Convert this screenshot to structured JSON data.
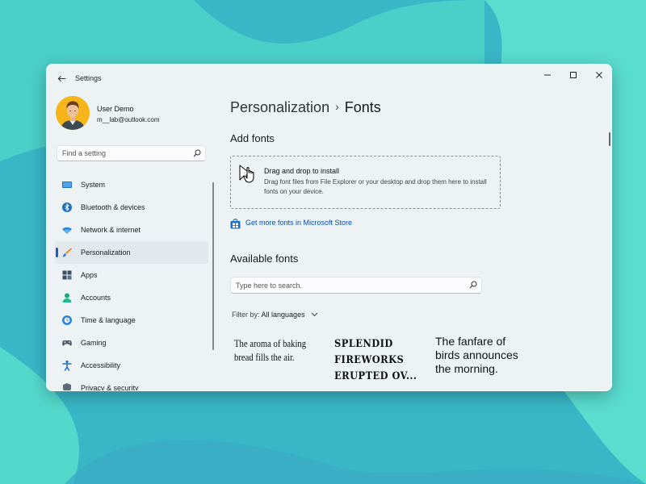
{
  "window": {
    "title": "Settings"
  },
  "profile": {
    "name": "User Demo",
    "email": "m__lab@outlook.com"
  },
  "sidebar": {
    "search_placeholder": "Find a setting",
    "items": [
      {
        "label": "System",
        "icon": "monitor-icon"
      },
      {
        "label": "Bluetooth & devices",
        "icon": "bluetooth-icon"
      },
      {
        "label": "Network & internet",
        "icon": "wifi-icon"
      },
      {
        "label": "Personalization",
        "icon": "brush-icon",
        "active": true
      },
      {
        "label": "Apps",
        "icon": "apps-icon"
      },
      {
        "label": "Accounts",
        "icon": "person-icon"
      },
      {
        "label": "Time & language",
        "icon": "globe-clock-icon"
      },
      {
        "label": "Gaming",
        "icon": "gamepad-icon"
      },
      {
        "label": "Accessibility",
        "icon": "accessibility-icon"
      },
      {
        "label": "Privacy & security",
        "icon": "shield-icon"
      }
    ]
  },
  "breadcrumb": {
    "parent": "Personalization",
    "separator": "›",
    "current": "Fonts"
  },
  "add_fonts": {
    "title": "Add fonts",
    "drop_title": "Drag and drop to install",
    "drop_desc": "Drag font files from File Explorer or your desktop and drop them here to install fonts on your device.",
    "store_link": "Get more fonts in Microsoft Store"
  },
  "available_fonts": {
    "title": "Available fonts",
    "search_placeholder": "Type here to search.",
    "filter_label": "Filter by:",
    "filter_value": "All languages",
    "samples": [
      "The aroma of baking bread fills the air.",
      "Splendid fireworks erupted ov...",
      "The fanfare of birds announces the morning."
    ]
  },
  "colors": {
    "accent": "#1a5fb4",
    "link": "#0b4fa8",
    "window_bg": "#edf3f5",
    "avatar_bg": "#f6b51a"
  }
}
